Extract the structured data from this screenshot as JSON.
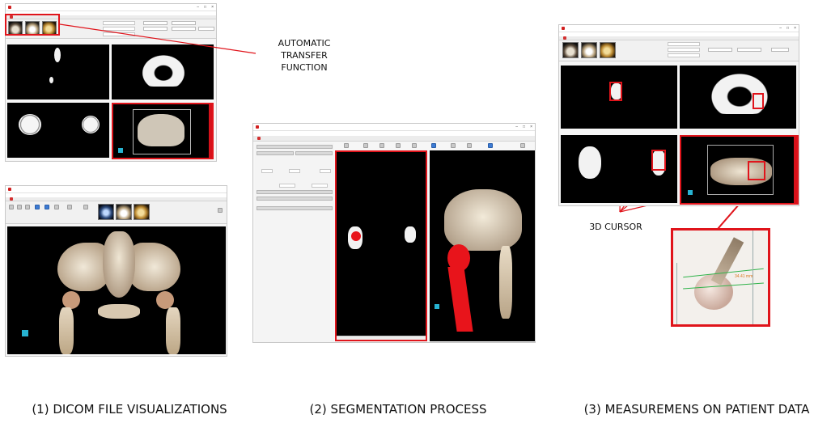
{
  "annotations": {
    "transfer_function": "AUTOMATIC\nTRANSFER FUNCTION",
    "cursor_3d": "3D CURSOR",
    "measurement_value": "34.41 mm"
  },
  "captions": {
    "panel1": "(1) DICOM FILE VISUALIZATIONS",
    "panel2": "(2) SEGMENTATION PROCESS",
    "panel3": "(3) MEASUREMENS ON PATIENT DATA"
  },
  "colors": {
    "highlight_red": "#e0141b",
    "segment_red": "#e8141b",
    "bone": "#e6dccb",
    "viewport_bg": "#000000"
  },
  "icons": [
    "window-minimize-icon",
    "window-maximize-icon",
    "window-close-icon",
    "app-icon",
    "tab-close-icon",
    "axis-gizmo-icon"
  ]
}
